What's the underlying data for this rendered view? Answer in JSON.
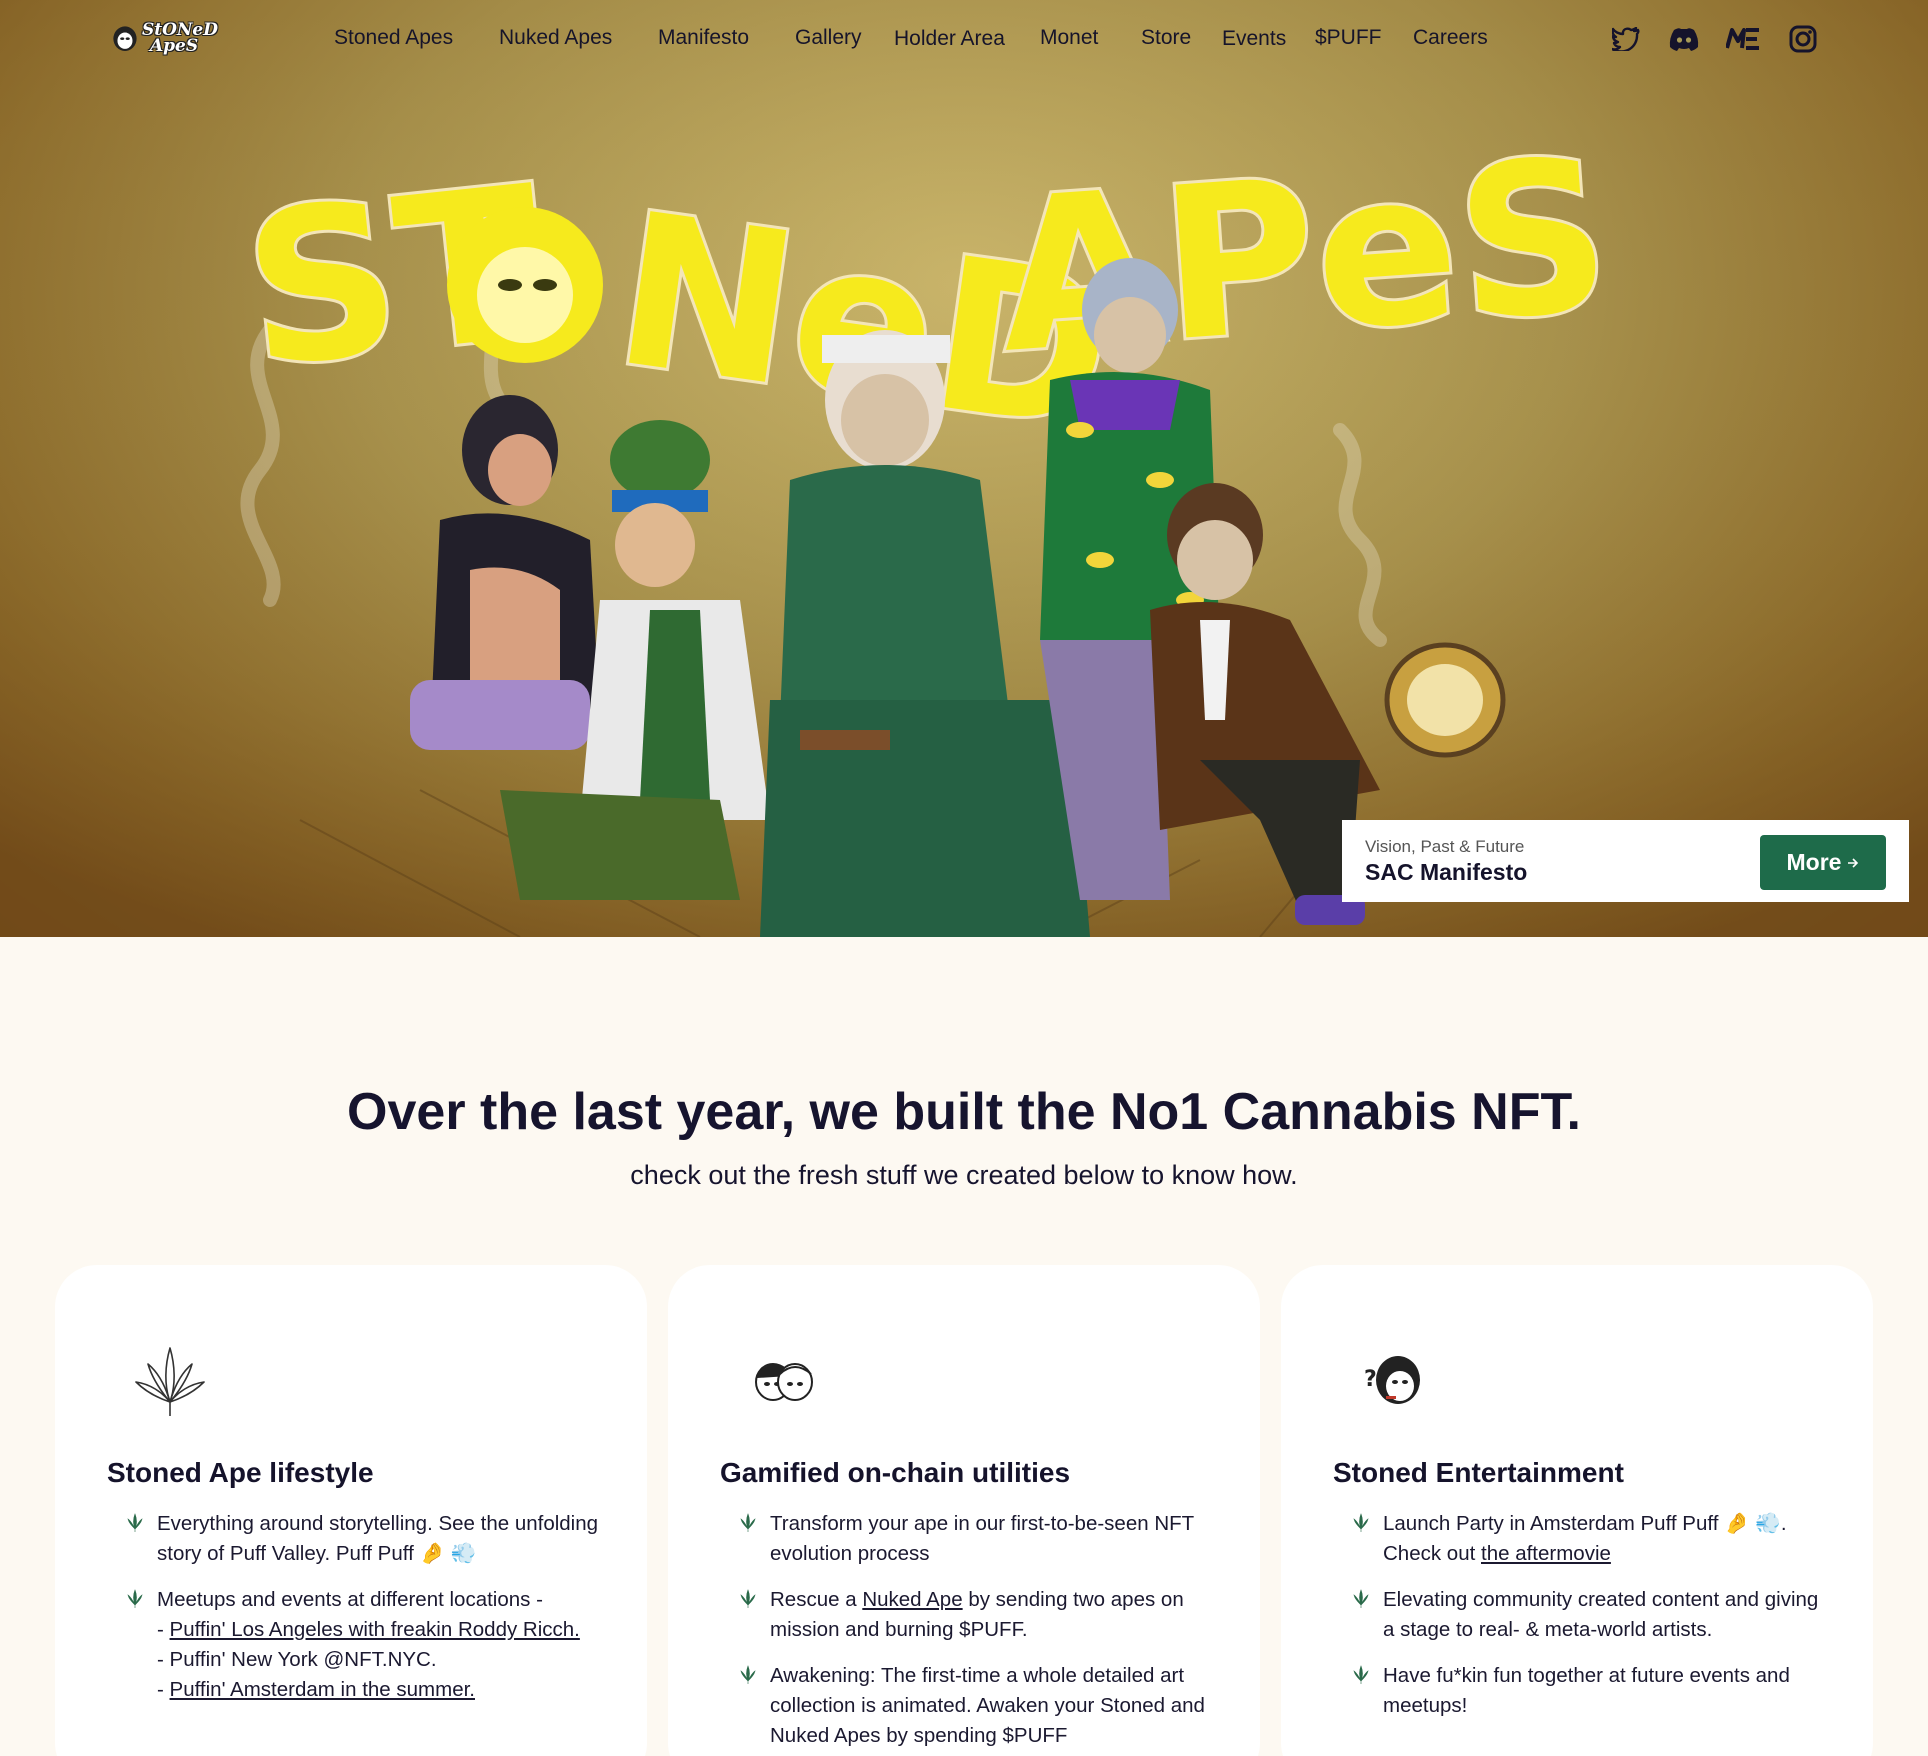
{
  "nav": {
    "logo_text_line1": "StONeD",
    "logo_text_line2": "ApeS",
    "links": [
      "Stoned Apes",
      "Nuked Apes",
      "Manifesto",
      "Gallery",
      "Holder Area",
      "Monet",
      "Store",
      "Events",
      "$PUFF",
      "Careers"
    ],
    "socials": [
      "twitter-icon",
      "discord-icon",
      "magic-eden-icon",
      "instagram-icon"
    ]
  },
  "hero": {
    "title_art": "StONeD ApeS",
    "manifesto_card": {
      "subtitle": "Vision, Past & Future",
      "title": "SAC Manifesto",
      "button_label": "More"
    }
  },
  "section": {
    "headline": "Over the last year, we built the No1 Cannabis NFT.",
    "subline": "check out the fresh stuff we created below to know how."
  },
  "cards": [
    {
      "icon": "cannabis-leaf-icon",
      "title": "Stoned Ape lifestyle",
      "items": [
        {
          "a": "Everything around storytelling. See the unfolding story of Puff Valley. Puff Puff 🤌 💨"
        },
        {
          "a": "Meetups and events at different locations -",
          "b": "- ",
          "c": "Puffin' Los Angeles with freakin Roddy Ricch.",
          "d": "- Puffin' New York @NFT.NYC.",
          "e": "- ",
          "f": "Puffin' Amsterdam in the summer."
        }
      ]
    },
    {
      "icon": "two-apes-icon",
      "title": "Gamified on-chain utilities",
      "items": [
        {
          "a": "Transform your ape in our first-to-be-seen NFT evolution process"
        },
        {
          "a": "Rescue a ",
          "b": "Nuked Ape",
          "c": " by sending two apes on mission and burning $PUFF."
        },
        {
          "a": "Awakening: The first-time a whole detailed art collection is animated. Awaken your Stoned and Nuked Apes by spending $PUFF"
        }
      ]
    },
    {
      "icon": "confused-ape-icon",
      "title": "Stoned Entertainment",
      "items": [
        {
          "a": "Launch Party in Amsterdam Puff Puff 🤌 💨.",
          "b": "Check out ",
          "c": "the aftermovie"
        },
        {
          "a": "Elevating community created content and giving a stage to real- & meta-world artists."
        },
        {
          "a": "Have fu*kin fun together at future events and meetups!"
        }
      ]
    }
  ],
  "colors": {
    "accent": "#1e6b4a",
    "title_yellow": "#f5e61c",
    "page_bg": "#fdf9f2"
  }
}
